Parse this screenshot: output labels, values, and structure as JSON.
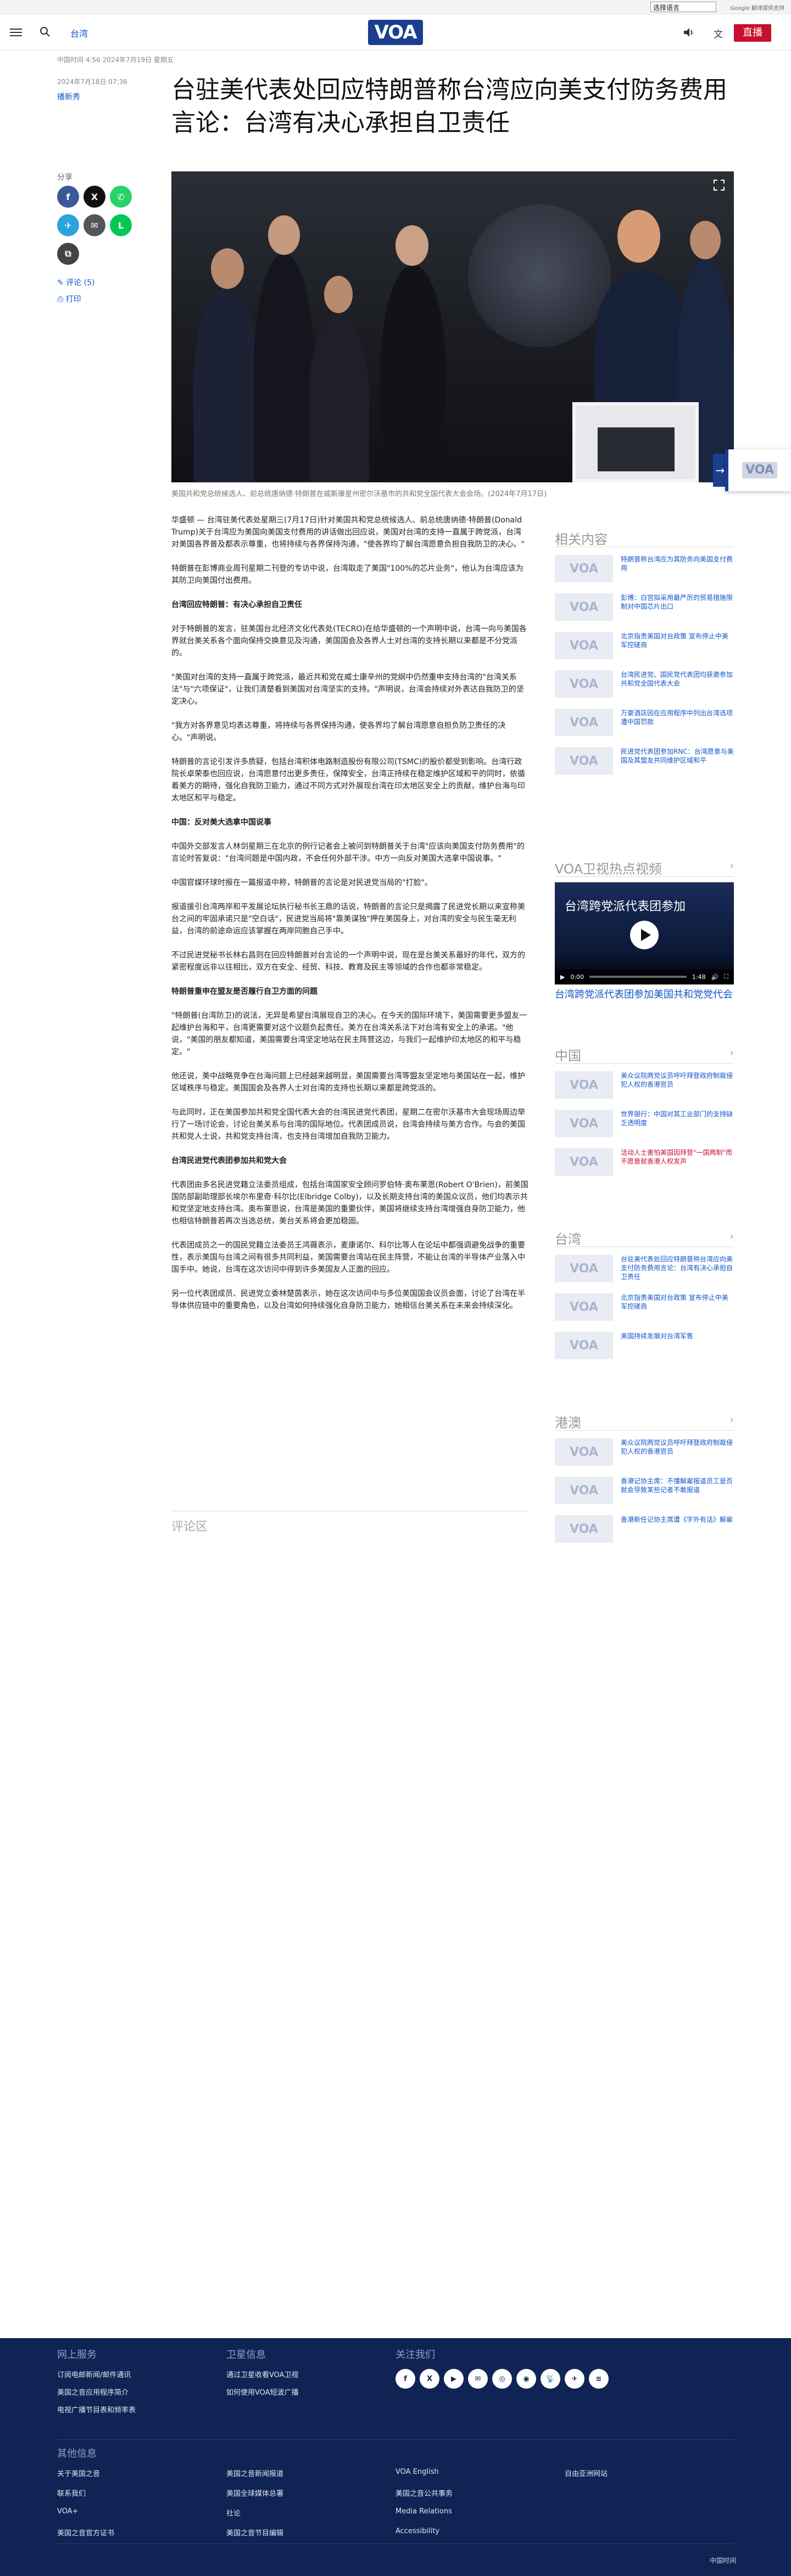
{
  "topbar": {
    "language_select": "选择语言",
    "translate_credit": "Google 翻译提供支持"
  },
  "header": {
    "section": "台湾",
    "logo": "VOA",
    "lang_icon": "文",
    "live_label": "直播"
  },
  "article": {
    "updated": "中国时间 4:56 2024年7月19日 星期五",
    "published": "2024年7月18日 07:36",
    "byline": "播新秀",
    "title": "台驻美代表处回应特朗普称台湾应向美支付防务费用言论：台湾有决心承担自卫责任",
    "share_label": "分享",
    "comment_link": "评论 (5)",
    "print_link": "打印",
    "caption": "美国共和党总统候选人、前总统唐纳德·特朗普在威斯康星州密尔沃基市的共和党全国代表大会会场。(2024年7月17日)",
    "paragraphs": [
      {
        "type": "p",
        "text": "华盛顿 — 台湾驻美代表处星期三(7月17日)针对美国共和党总统候选人、前总统唐纳德·特朗普(Donald Trump)关于台湾应为美国向美国支付费用的讲话做出回应说，美国对台湾的支持一直属于跨党派，台湾对美国各界普及都表示尊重，也将持续与各界保持沟通，\"使各界均了解台湾愿意负担自我防卫的决心。\""
      },
      {
        "type": "p",
        "text": "特朗普在彭博商业周刊星期二刊登的专访中说，台湾取走了美国\"100%的芯片业务\"，他认为台湾应该为其防卫向美国付出费用。"
      },
      {
        "type": "sub",
        "text": "台湾回应特朗普：有决心承担自卫责任"
      },
      {
        "type": "p",
        "text": "对于特朗普的发言，驻美国台北经济文化代表处(TECRO)在给华盛顿的一个声明中说，台湾一向与美国各界就台美关系各个面向保持交换意见及沟通，美国国会及各界人士对台湾的支持长期以来都是不分党派的。"
      },
      {
        "type": "p",
        "text": "\"美国对台湾的支持一直属于跨党派，最近共和党在威士康辛州的党纲中仍然重申支持台湾的\"台湾关系法\"与\"六项保证\"，让我们清楚看到美国对台湾坚实的支持。\"声明说，台湾会持续对外表达自我防卫的坚定决心。"
      },
      {
        "type": "p",
        "text": "\"我方对各界意见均表达尊重，将持续与各界保持沟通，使各界均了解台湾愿意自担负防卫责任的决心。\"声明说。"
      },
      {
        "type": "p",
        "text": "特朗普的言论引发许多质疑，包括台湾积体电路制造股份有限公司(TSMC)的股价都受到影响。台湾行政院长卓荣泰也回应说，台湾愿意付出更多责任，保障安全，台湾正持续在稳定维护区域和平的同时，依循着美方的期待，强化自我防卫能力，通过不同方式对外展现台湾在印太地区安全上的贡献，维护台海与印太地区和平与稳定。"
      },
      {
        "type": "sub",
        "text": "中国：反对美大选拿中国说事"
      },
      {
        "type": "p",
        "text": "中国外交部发言人林剑星期三在北京的例行记者会上被问到特朗普关于台湾\"应该向美国支付防务费用\"的言论时答复说：\"台湾问题是中国内政，不会任何外部干涉。中方一向反对美国大选拿中国说事。\""
      },
      {
        "type": "p",
        "text": "中国官媒环球时报在一篇报道中称，特朗普的言论是对民进党当局的\"打脸\"。"
      },
      {
        "type": "p",
        "text": "报道援引台湾两岸和平发展论坛执行秘书长王鼎的话说，特朗普的言论只是揭露了民进党长期以来宣称美台之间的牢固承诺只是\"空白话\"，民进党当局将\"靠美谋独\"押在美国身上，对台湾的安全与民生毫无利益，台湾的前途命运应该掌握在两岸同胞自己手中。"
      },
      {
        "type": "p",
        "text": "不过民进党秘书长林右昌则在回应特朗普对台言论的一个声明中说，现在是台美关系最好的年代，双方的紧密程度远非以往相比，双方在安全、经贸、科技、教育及民主等领域的合作也都非常稳定。"
      },
      {
        "type": "sub",
        "text": "特朗普重申在盟友是否履行自卫方面的问题"
      },
      {
        "type": "p",
        "text": "\"特朗普(台湾防卫)的说法，无异是希望台湾展现自卫的决心。在今天的国际环境下，美国需要更多盟友一起维护台海和平，台湾更需要对这个议题负起责任。美方在台湾关系法下对台湾有安全上的承诺。\"他说，\"美国的朋友都知道，美国需要台湾坚定地站在民主阵营这边，与我们一起维护印太地区的和平与稳定。\""
      },
      {
        "type": "p",
        "text": "他还说，美中战略竞争在台海问题上已经越来越明显，美国需要台湾等盟友坚定地与美国站在一起，维护区域秩序与稳定。美国国会及各界人士对台湾的支持也长期以来都是跨党派的。"
      },
      {
        "type": "p",
        "text": "与此同时，正在美国参加共和党全国代表大会的台湾民进党代表团，星期二在密尔沃基市大会现场周边举行了一场讨论会，讨论台美关系与台湾的国际地位。代表团成员说，台湾会持续与美方合作。与会的美国共和党人士说，共和党支持台湾，也支持台湾增加自我防卫能力。"
      },
      {
        "type": "sub",
        "text": "台湾民进党代表团参加共和党大会"
      },
      {
        "type": "p",
        "text": "代表团由多名民进党籍立法委员组成，包括台湾国家安全顾问罗伯特·奥布莱恩(Robert O'Brien)，前美国国防部副助理部长埃尔布里奇·科尔比(Elbridge Colby)，以及长期支持台湾的美国众议员，他们均表示共和党坚定地支持台湾。奥布莱恩说，台湾是美国的重要伙伴，美国将继续支持台湾增强自身防卫能力，他也相信特朗普若再次当选总统，美台关系将会更加稳固。"
      },
      {
        "type": "p",
        "text": "代表团成员之一的国民党籍立法委员王鸿薇表示，麦康诺尔、科尔比等人在论坛中都强调避免战争的重要性，表示美国与台湾之间有很多共同利益，美国需要台湾站在民主阵营，不能让台湾的半导体产业落入中国手中。她说，台湾在这次访问中得到许多美国友人正面的回应。"
      },
      {
        "type": "p",
        "text": "另一位代表团成员、民进党立委林楚茵表示，她在这次访问中与多位美国国会议员会面，讨论了台湾在半导体供应链中的重要角色，以及台湾如何持续强化自身防卫能力，她相信台美关系在未来会持续深化。"
      }
    ],
    "comments_heading": "评论区"
  },
  "sidebar": {
    "related_heading": "相关内容",
    "related": [
      {
        "text": "特朗普称台湾应为其防务向美国支付费用"
      },
      {
        "text": "彭博：白宫拟采用最严厉的贸易措施限制对中国芯片出口"
      },
      {
        "text": "北京指责美国对台政策 宣布停止中美军控磋商"
      },
      {
        "text": "台湾民进党、国民党代表团均获邀参加共和党全国代表大会"
      },
      {
        "text": "万豪酒店因在应用程序中列出台湾选项遭中国罚款"
      },
      {
        "text": "民进党代表团参加RNC：台湾愿意与美国及其盟友共同维护区域和平"
      }
    ],
    "video_heading": "VOA卫视热点视频",
    "video_title": "台湾跨党派代表团参加",
    "video_time_current": "0:00",
    "video_time_total": "1:48",
    "video_progress": 0.0,
    "video_caption": "台湾跨党派代表团参加美国共和党党代会",
    "china_heading": "中国",
    "china": [
      {
        "text": "美众议院两党议员呼吁拜登政府制裁侵犯人权的香港官员",
        "red": false
      },
      {
        "text": "世界银行：中国对其工业部门的支持缺乏透明度",
        "red": false
      },
      {
        "text": "活动人士害怕美国因拜登\"一国两制\"而不愿意就香港人权发声",
        "red": true
      }
    ],
    "taiwan_heading": "台湾",
    "taiwan": [
      {
        "text": "台驻美代表处回应特朗普称台湾应向美支付防务费用言论：台湾有决心承担自卫责任"
      },
      {
        "text": "北京指责美国对台政策 宣布停止中美军控磋商"
      },
      {
        "text": "美国持续发展对台湾军售"
      }
    ],
    "hk_heading": "港澳",
    "hk": [
      {
        "text": "美众议院两党议员呼吁拜登政府制裁侵犯人权的香港官员"
      },
      {
        "text": "香港记协主席：不懂解雇报道员工是否就会导致某些记者不敢报道"
      },
      {
        "text": "香港新任记协主席遭《字外有话》解雇"
      }
    ]
  },
  "footer": {
    "online_heading": "网上服务",
    "online_links": [
      "订阅电邮新闻/邮件通讯",
      "美国之音应用程序简介",
      "电视广播节目表和频率表"
    ],
    "sat_heading": "卫星信息",
    "sat_links": [
      "通过卫星收看VOA卫视",
      "如何使用VOA短波广播"
    ],
    "follow_heading": "关注我们",
    "social_icons": [
      "f",
      "X",
      "▶",
      "✉",
      "◎",
      "◉",
      "📡",
      "✈",
      "≡"
    ],
    "other_heading": "其他信息",
    "col1": [
      "关于美国之音",
      "联系我们",
      "VOA+",
      "美国之音官方证书"
    ],
    "col2": [
      "美国之音新闻报道",
      "美国全球媒体总署",
      "社论",
      "美国之音节目编辑"
    ],
    "col3": [
      "VOA English",
      "美国之音公共事务",
      "Media Relations",
      "Accessibility"
    ],
    "col4": [
      "自由亚洲网站"
    ],
    "copyright": "中国时间"
  }
}
